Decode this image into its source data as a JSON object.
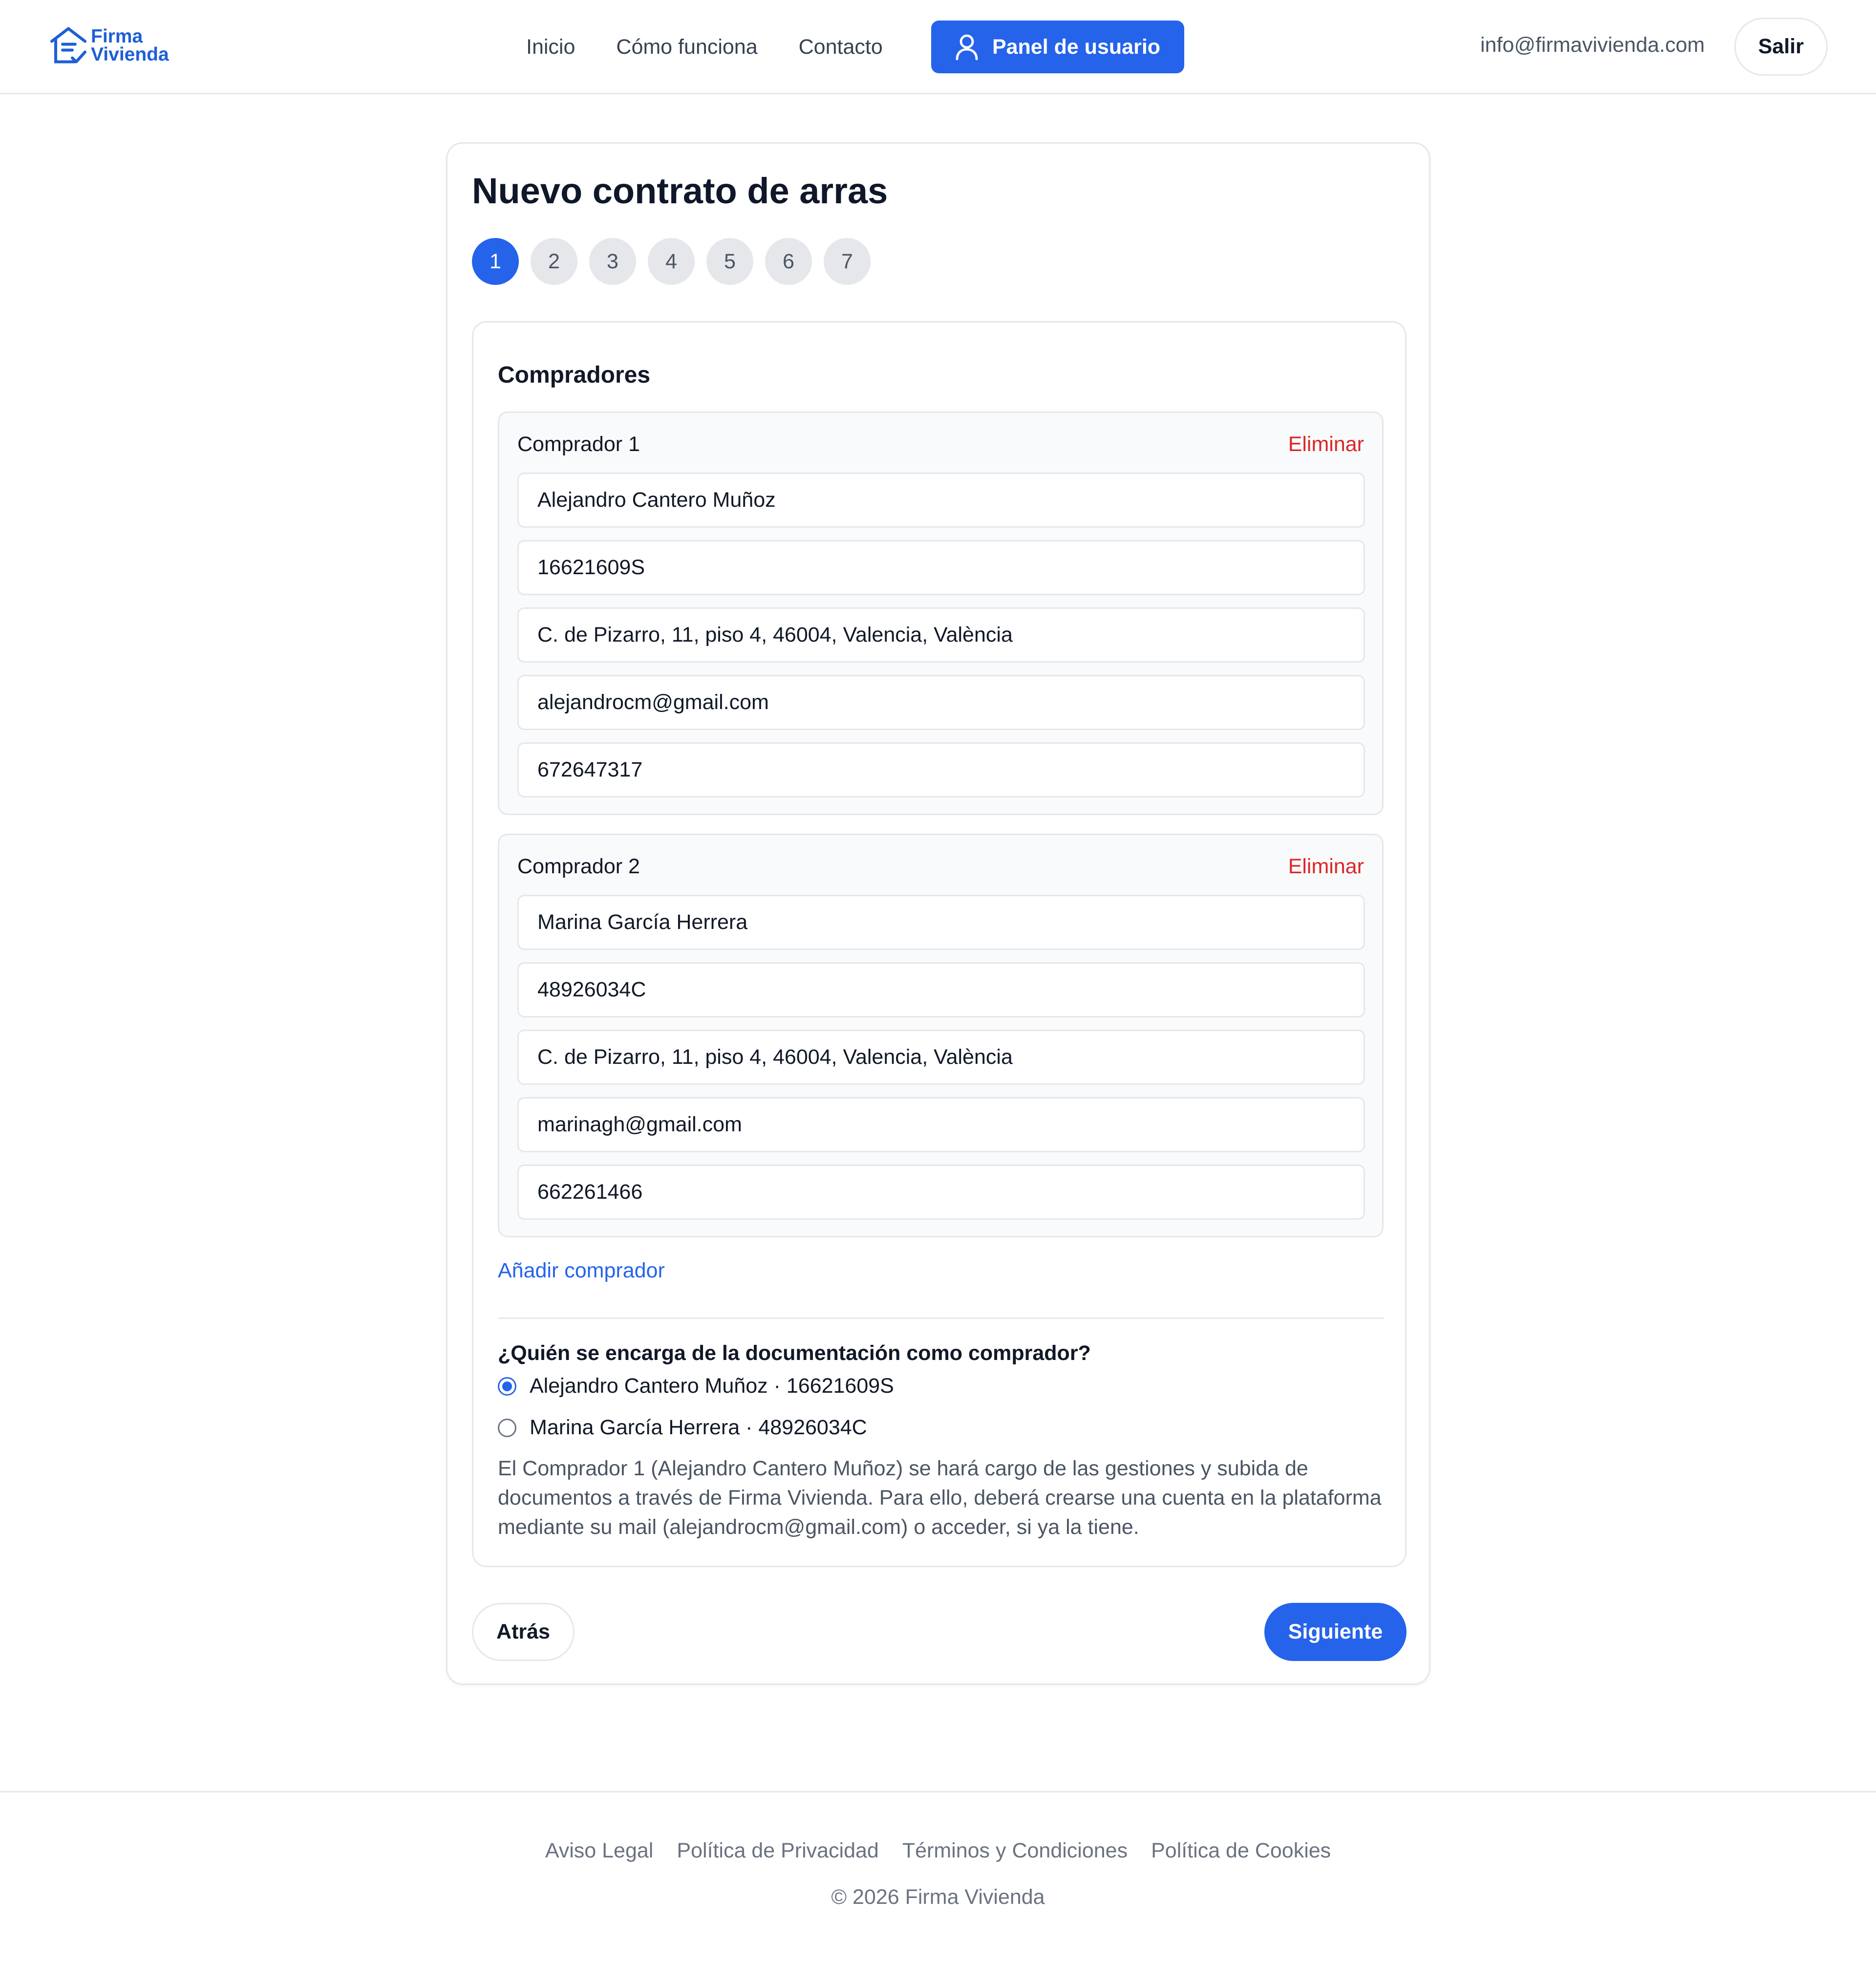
{
  "header": {
    "logo_line1": "Firma",
    "logo_line2": "Vivienda",
    "nav": [
      "Inicio",
      "Cómo funciona",
      "Contacto"
    ],
    "panel_button": "Panel de usuario",
    "email": "info@firmavivienda.com",
    "logout": "Salir"
  },
  "page": {
    "title": "Nuevo contrato de arras",
    "steps": [
      "1",
      "2",
      "3",
      "4",
      "5",
      "6",
      "7"
    ],
    "active_step": 1
  },
  "buyers_section": {
    "title": "Compradores",
    "delete_label": "Eliminar",
    "buyers": [
      {
        "label": "Comprador 1",
        "name": "Alejandro Cantero Muñoz",
        "dni": "16621609S",
        "address": "C. de Pizarro, 11, piso 4, 46004, Valencia, València",
        "email": "alejandrocm@gmail.com",
        "phone": "672647317"
      },
      {
        "label": "Comprador 2",
        "name": "Marina García Herrera",
        "dni": "48926034C",
        "address": "C. de Pizarro, 11, piso 4, 46004, Valencia, València",
        "email": "marinagh@gmail.com",
        "phone": "662261466"
      }
    ],
    "add_buyer": "Añadir comprador",
    "question": "¿Quién se encarga de la documentación como comprador?",
    "options": [
      {
        "label": "Alejandro Cantero Muñoz · 16621609S",
        "selected": true
      },
      {
        "label": "Marina García Herrera · 48926034C",
        "selected": false
      }
    ],
    "info": "El Comprador 1 (Alejandro Cantero Muñoz) se hará cargo de las gestiones y subida de documentos a través de Firma Vivienda. Para ello, deberá crearse una cuenta en la plataforma mediante su mail (alejandrocm@gmail.com) o acceder, si ya la tiene."
  },
  "actions": {
    "back": "Atrás",
    "next": "Siguiente"
  },
  "footer": {
    "links": [
      "Aviso Legal",
      "Política de Privacidad",
      "Términos y Condiciones",
      "Política de Cookies"
    ],
    "copyright": "© 2026 Firma Vivienda"
  },
  "colors": {
    "primary": "#2563eb",
    "danger": "#dc2626",
    "border": "#e5e7eb",
    "muted": "#6b7280"
  }
}
